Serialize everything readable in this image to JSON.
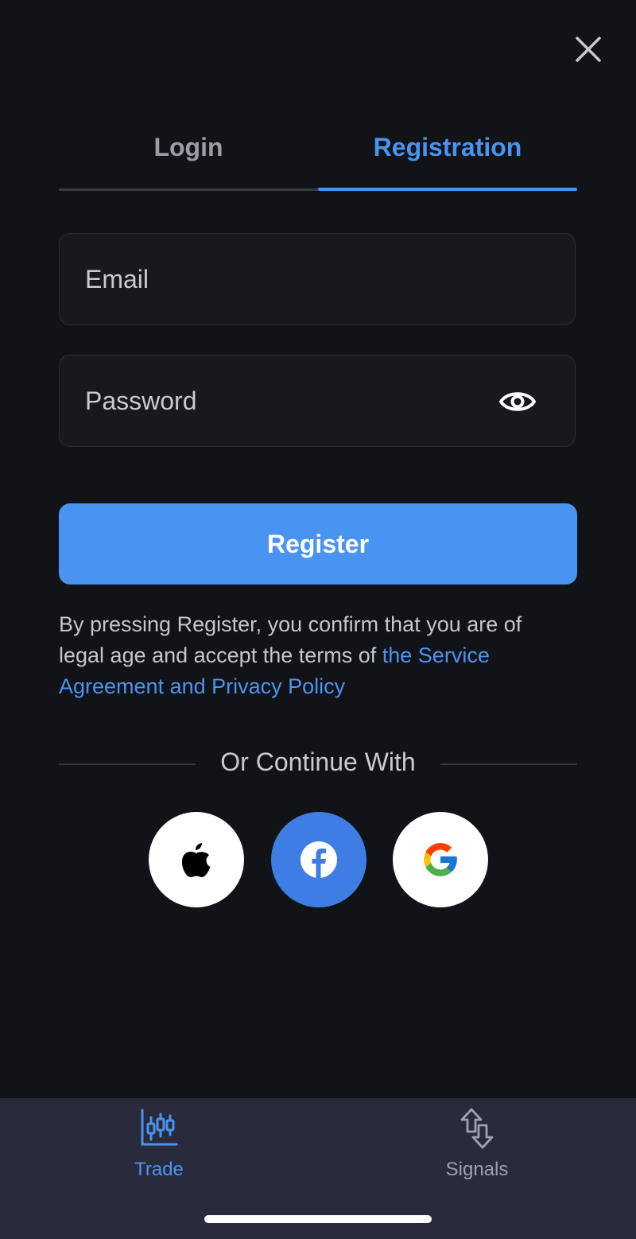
{
  "tabs": {
    "login": "Login",
    "registration": "Registration",
    "active": "Registration"
  },
  "form": {
    "email_placeholder": "Email",
    "password_placeholder": "Password",
    "register_label": "Register"
  },
  "terms": {
    "text": "By pressing Register, you confirm that you are of legal age and accept the terms of ",
    "link": "the Service Agreement and Privacy Policy"
  },
  "social": {
    "divider_text": "Or Continue With",
    "providers": [
      "apple-icon",
      "facebook-icon",
      "google-icon"
    ]
  },
  "bottom_nav": {
    "items": [
      {
        "label": "Trade",
        "icon": "candlestick-chart-icon",
        "active": true
      },
      {
        "label": "Signals",
        "icon": "arrows-up-down-icon",
        "active": false
      }
    ]
  },
  "colors": {
    "background": "#121317",
    "accent": "#4a94f1",
    "facebook": "#3e7ee4",
    "nav_background": "#292b3d"
  }
}
